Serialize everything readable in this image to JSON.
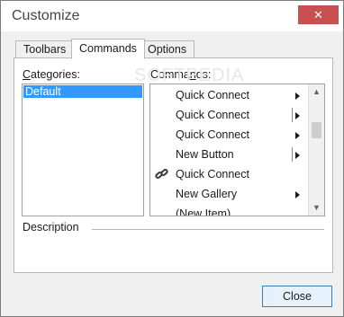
{
  "window": {
    "title": "Customize",
    "close_glyph": "✕"
  },
  "tabs": [
    {
      "label": "Toolbars",
      "active": false
    },
    {
      "label": "Commands",
      "active": true
    },
    {
      "label": "Options",
      "active": false
    }
  ],
  "categories": {
    "label_prefix": "",
    "label_access": "C",
    "label_rest": "ategories:",
    "items": [
      "Default"
    ],
    "selected": "Default"
  },
  "commands": {
    "label_prefix": "Comma",
    "label_access": "n",
    "label_rest": "ds:",
    "items": [
      {
        "label": "Quick Connect",
        "icon": "",
        "submenu": "arrow"
      },
      {
        "label": "Quick Connect",
        "icon": "",
        "submenu": "split-arrow"
      },
      {
        "label": "Quick Connect",
        "icon": "",
        "submenu": "arrow"
      },
      {
        "label": "New Button",
        "icon": "",
        "submenu": "split-arrow"
      },
      {
        "label": "Quick Connect",
        "icon": "chain-link-icon",
        "submenu": ""
      },
      {
        "label": "New Gallery",
        "icon": "",
        "submenu": "arrow"
      },
      {
        "label": "(New Item)",
        "icon": "",
        "submenu": ""
      }
    ],
    "scroll_up_glyph": "▲",
    "scroll_down_glyph": "▼"
  },
  "description": {
    "label": "Description"
  },
  "watermark": "SOFTPEDIA",
  "buttons": {
    "close_label": "Close"
  },
  "colors": {
    "selection": "#3399ff",
    "title_close": "#c75050",
    "button_border": "#3c7fb1"
  }
}
